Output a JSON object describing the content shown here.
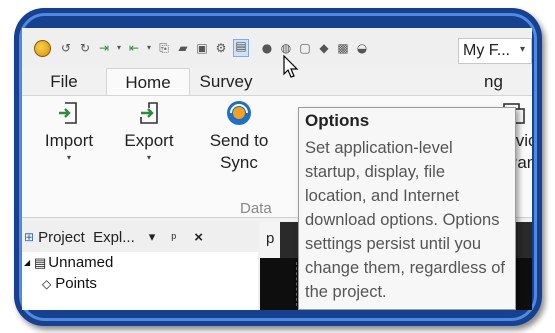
{
  "window": {
    "title": "My F..."
  },
  "quick_access": {
    "icons": [
      "app-logo-icon",
      "undo-icon",
      "redo-icon",
      "import-icon",
      "export-icon",
      "send-icon",
      "briefcase-icon",
      "save-icon",
      "gear-icon",
      "options-icon",
      "satellite-icon",
      "globe-icon",
      "window-icon",
      "cube-icon",
      "image-icon",
      "dish-icon"
    ]
  },
  "tabs": [
    {
      "label": "File"
    },
    {
      "label": "Home"
    },
    {
      "label": "Survey"
    },
    {
      "label": "ng"
    }
  ],
  "ribbon": {
    "buttons": [
      {
        "label": "Import",
        "has_dropdown": true
      },
      {
        "label": "Export",
        "has_dropdown": true
      },
      {
        "label": "Send to",
        "label2": "Sync"
      },
      {
        "label": "Devic",
        "label2": "Pan"
      }
    ],
    "group_label": "Data"
  },
  "project_explorer": {
    "title": "Project  Expl...",
    "controls": {
      "dropdown": "▾",
      "pin": "ᵖ",
      "close": "×"
    },
    "tree": [
      {
        "label": "Unnamed",
        "expanded": true
      },
      {
        "label": "Points"
      }
    ]
  },
  "document_tab": {
    "label": "p"
  },
  "tooltip": {
    "title": "Options",
    "body": "Set application-level startup, display, file location, and Internet download options. Options settings persist until you change them, regardless of the project."
  },
  "colors": {
    "frame": "#17408f",
    "frame_inner_border": "#4f8ae0",
    "ribbon_bg": "#fafafa",
    "accent_green": "#2e8b3e"
  }
}
